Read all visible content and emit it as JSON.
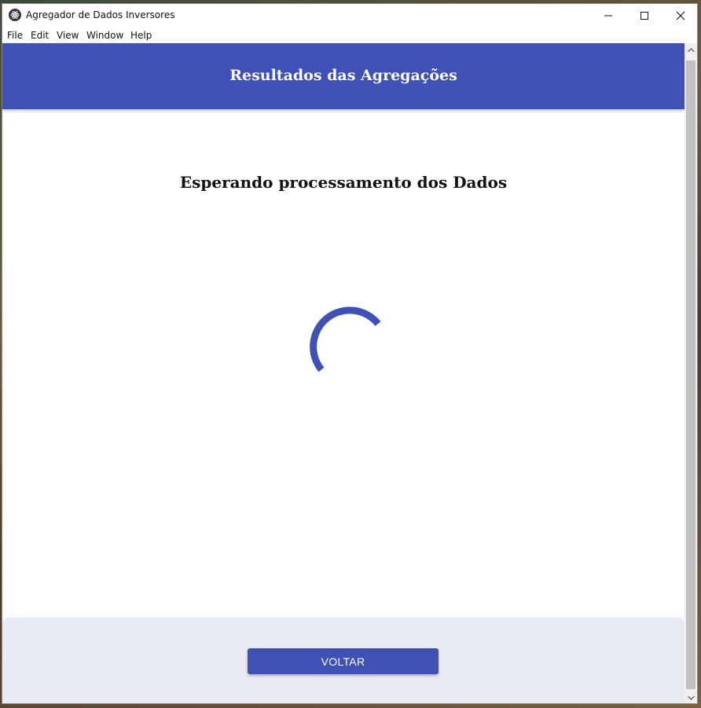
{
  "window": {
    "title": "Agregador de Dados Inversores"
  },
  "menu": {
    "file": "File",
    "edit": "Edit",
    "view": "View",
    "window": "Window",
    "help": "Help"
  },
  "header": {
    "title": "Resultados das Agregações"
  },
  "main": {
    "status_text": "Esperando processamento dos Dados"
  },
  "footer": {
    "back_label": "VOLTAR"
  },
  "icons": {
    "app": "electron-atom-icon",
    "minimize": "minimize-icon",
    "maximize": "maximize-icon",
    "close": "close-icon",
    "spinner": "loading-spinner"
  },
  "colors": {
    "primary": "#3f51b5",
    "footer_bg": "#e8eaf6"
  }
}
